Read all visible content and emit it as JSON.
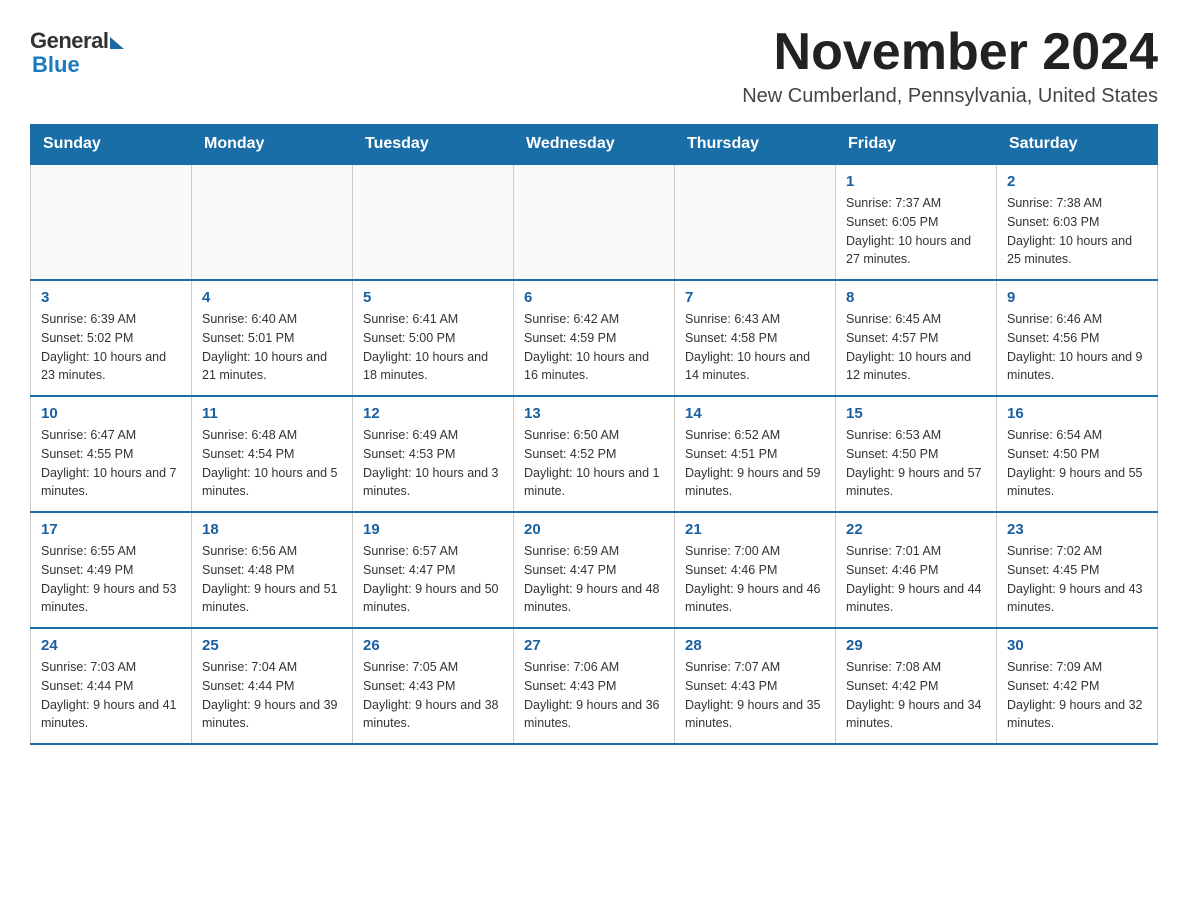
{
  "logo": {
    "general": "General",
    "blue": "Blue"
  },
  "header": {
    "month_year": "November 2024",
    "location": "New Cumberland, Pennsylvania, United States"
  },
  "weekdays": [
    "Sunday",
    "Monday",
    "Tuesday",
    "Wednesday",
    "Thursday",
    "Friday",
    "Saturday"
  ],
  "weeks": [
    [
      {
        "day": "",
        "info": ""
      },
      {
        "day": "",
        "info": ""
      },
      {
        "day": "",
        "info": ""
      },
      {
        "day": "",
        "info": ""
      },
      {
        "day": "",
        "info": ""
      },
      {
        "day": "1",
        "info": "Sunrise: 7:37 AM\nSunset: 6:05 PM\nDaylight: 10 hours and 27 minutes."
      },
      {
        "day": "2",
        "info": "Sunrise: 7:38 AM\nSunset: 6:03 PM\nDaylight: 10 hours and 25 minutes."
      }
    ],
    [
      {
        "day": "3",
        "info": "Sunrise: 6:39 AM\nSunset: 5:02 PM\nDaylight: 10 hours and 23 minutes."
      },
      {
        "day": "4",
        "info": "Sunrise: 6:40 AM\nSunset: 5:01 PM\nDaylight: 10 hours and 21 minutes."
      },
      {
        "day": "5",
        "info": "Sunrise: 6:41 AM\nSunset: 5:00 PM\nDaylight: 10 hours and 18 minutes."
      },
      {
        "day": "6",
        "info": "Sunrise: 6:42 AM\nSunset: 4:59 PM\nDaylight: 10 hours and 16 minutes."
      },
      {
        "day": "7",
        "info": "Sunrise: 6:43 AM\nSunset: 4:58 PM\nDaylight: 10 hours and 14 minutes."
      },
      {
        "day": "8",
        "info": "Sunrise: 6:45 AM\nSunset: 4:57 PM\nDaylight: 10 hours and 12 minutes."
      },
      {
        "day": "9",
        "info": "Sunrise: 6:46 AM\nSunset: 4:56 PM\nDaylight: 10 hours and 9 minutes."
      }
    ],
    [
      {
        "day": "10",
        "info": "Sunrise: 6:47 AM\nSunset: 4:55 PM\nDaylight: 10 hours and 7 minutes."
      },
      {
        "day": "11",
        "info": "Sunrise: 6:48 AM\nSunset: 4:54 PM\nDaylight: 10 hours and 5 minutes."
      },
      {
        "day": "12",
        "info": "Sunrise: 6:49 AM\nSunset: 4:53 PM\nDaylight: 10 hours and 3 minutes."
      },
      {
        "day": "13",
        "info": "Sunrise: 6:50 AM\nSunset: 4:52 PM\nDaylight: 10 hours and 1 minute."
      },
      {
        "day": "14",
        "info": "Sunrise: 6:52 AM\nSunset: 4:51 PM\nDaylight: 9 hours and 59 minutes."
      },
      {
        "day": "15",
        "info": "Sunrise: 6:53 AM\nSunset: 4:50 PM\nDaylight: 9 hours and 57 minutes."
      },
      {
        "day": "16",
        "info": "Sunrise: 6:54 AM\nSunset: 4:50 PM\nDaylight: 9 hours and 55 minutes."
      }
    ],
    [
      {
        "day": "17",
        "info": "Sunrise: 6:55 AM\nSunset: 4:49 PM\nDaylight: 9 hours and 53 minutes."
      },
      {
        "day": "18",
        "info": "Sunrise: 6:56 AM\nSunset: 4:48 PM\nDaylight: 9 hours and 51 minutes."
      },
      {
        "day": "19",
        "info": "Sunrise: 6:57 AM\nSunset: 4:47 PM\nDaylight: 9 hours and 50 minutes."
      },
      {
        "day": "20",
        "info": "Sunrise: 6:59 AM\nSunset: 4:47 PM\nDaylight: 9 hours and 48 minutes."
      },
      {
        "day": "21",
        "info": "Sunrise: 7:00 AM\nSunset: 4:46 PM\nDaylight: 9 hours and 46 minutes."
      },
      {
        "day": "22",
        "info": "Sunrise: 7:01 AM\nSunset: 4:46 PM\nDaylight: 9 hours and 44 minutes."
      },
      {
        "day": "23",
        "info": "Sunrise: 7:02 AM\nSunset: 4:45 PM\nDaylight: 9 hours and 43 minutes."
      }
    ],
    [
      {
        "day": "24",
        "info": "Sunrise: 7:03 AM\nSunset: 4:44 PM\nDaylight: 9 hours and 41 minutes."
      },
      {
        "day": "25",
        "info": "Sunrise: 7:04 AM\nSunset: 4:44 PM\nDaylight: 9 hours and 39 minutes."
      },
      {
        "day": "26",
        "info": "Sunrise: 7:05 AM\nSunset: 4:43 PM\nDaylight: 9 hours and 38 minutes."
      },
      {
        "day": "27",
        "info": "Sunrise: 7:06 AM\nSunset: 4:43 PM\nDaylight: 9 hours and 36 minutes."
      },
      {
        "day": "28",
        "info": "Sunrise: 7:07 AM\nSunset: 4:43 PM\nDaylight: 9 hours and 35 minutes."
      },
      {
        "day": "29",
        "info": "Sunrise: 7:08 AM\nSunset: 4:42 PM\nDaylight: 9 hours and 34 minutes."
      },
      {
        "day": "30",
        "info": "Sunrise: 7:09 AM\nSunset: 4:42 PM\nDaylight: 9 hours and 32 minutes."
      }
    ]
  ]
}
